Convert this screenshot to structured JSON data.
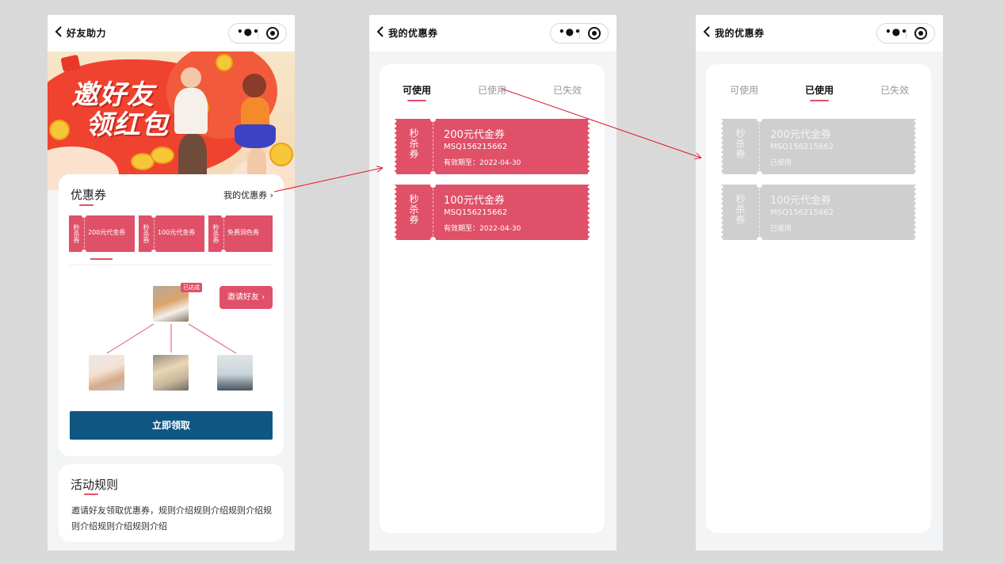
{
  "colors": {
    "accent": "#e05068",
    "primary_button": "#0f5782",
    "canvas": "#d9d9d9"
  },
  "screen1": {
    "nav_title": "好友助力",
    "banner_line1": "邀好友",
    "banner_line2": "领红包",
    "coupon_section_title": "优惠券",
    "my_coupons_link": "我的优惠券",
    "link_arrow": "›",
    "mini_coupons": [
      {
        "tag": "秒杀券",
        "label": "200元代金券"
      },
      {
        "tag": "秒杀券",
        "label": "100元代金券"
      },
      {
        "tag": "秒杀券",
        "label": "免费洞色券"
      }
    ],
    "achieved_badge": "已达成",
    "invite_button": "邀请好友",
    "invite_arrow": "›",
    "claim_button": "立即领取",
    "rules_title": "活动规则",
    "rules_text": "邀请好友领取优惠券，规则介绍规则介绍规则介绍规则介绍规则介绍规则介绍"
  },
  "screen2": {
    "nav_title": "我的优惠券",
    "tabs": [
      {
        "label": "可使用"
      },
      {
        "label": "已使用"
      },
      {
        "label": "已失效"
      }
    ],
    "active_tab": "可使用",
    "coupons": [
      {
        "tag": "秒杀券",
        "title": "200元代金券",
        "code": "MSQ156215662",
        "validity": "有效期至：2022-04-30"
      },
      {
        "tag": "秒杀券",
        "title": "100元代金券",
        "code": "MSQ156215662",
        "validity": "有效期至：2022-04-30"
      }
    ]
  },
  "screen3": {
    "nav_title": "我的优惠券",
    "tabs": [
      {
        "label": "可使用"
      },
      {
        "label": "已使用"
      },
      {
        "label": "已失效"
      }
    ],
    "active_tab": "已使用",
    "coupons": [
      {
        "tag": "秒杀券",
        "title": "200元代金券",
        "code": "MSQ156215662",
        "status": "已使用"
      },
      {
        "tag": "秒杀券",
        "title": "100元代金券",
        "code": "MSQ156215662",
        "status": "已使用"
      }
    ]
  },
  "capsule_icons": [
    "more-dots-icon",
    "target-icon"
  ]
}
